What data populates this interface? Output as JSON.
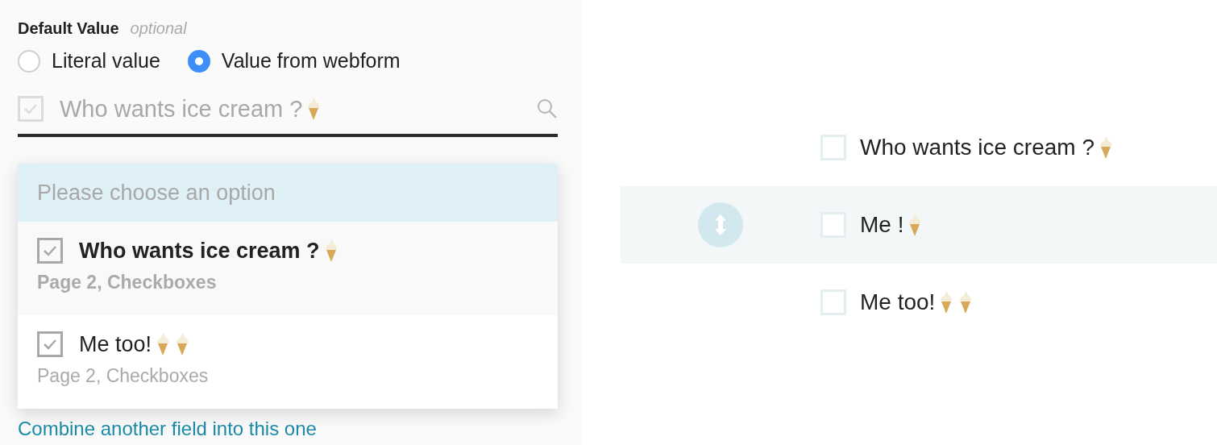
{
  "default_value": {
    "label": "Default Value",
    "hint": "optional"
  },
  "radios": [
    {
      "label": "Literal value",
      "selected": false
    },
    {
      "label": "Value from webform",
      "selected": true
    }
  ],
  "field": {
    "checked": true,
    "value": "Who wants ice cream ?",
    "icons": [
      {
        "kind": "cone"
      }
    ]
  },
  "dropdown": {
    "placeholder": "Please choose an option",
    "options": [
      {
        "label": "Who wants ice cream ?",
        "icons": [
          {
            "kind": "cone"
          }
        ],
        "checked": true,
        "source": "Page 2, Checkboxes",
        "selected": true
      },
      {
        "label": "Me too!",
        "icons": [
          {
            "kind": "cone"
          },
          {
            "kind": "cone"
          }
        ],
        "checked": true,
        "source": "Page 2, Checkboxes",
        "selected": false
      }
    ]
  },
  "link": "Combine another field into this one",
  "preview": {
    "items": [
      {
        "label": "Who wants ice cream ?",
        "icons": [
          {
            "kind": "cone"
          }
        ],
        "checked": false,
        "dragging": false
      },
      {
        "label": "Me !",
        "icons": [
          {
            "kind": "cone"
          }
        ],
        "checked": false,
        "dragging": true
      },
      {
        "label": "Me too!",
        "icons": [
          {
            "kind": "cone"
          },
          {
            "kind": "cone"
          }
        ],
        "checked": false,
        "dragging": false
      }
    ]
  }
}
